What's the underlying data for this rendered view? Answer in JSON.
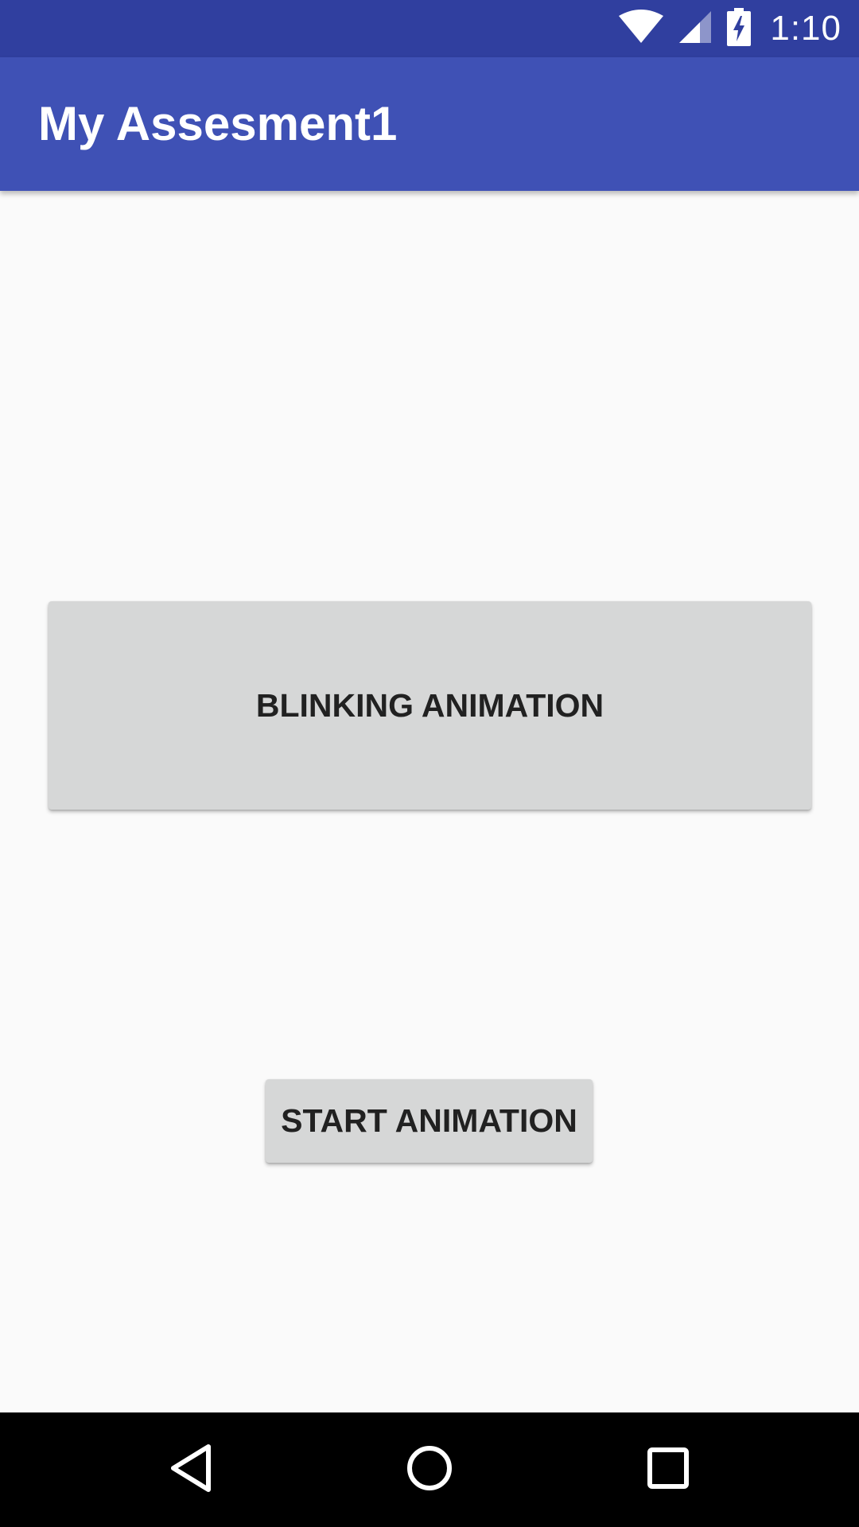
{
  "status_bar": {
    "time": "1:10",
    "icons": [
      "wifi-icon",
      "cell-signal-icon",
      "battery-charging-icon"
    ],
    "background_color": "#303f9f"
  },
  "app_bar": {
    "title": "My Assesment1",
    "background_color": "#3f51b5"
  },
  "main": {
    "blink_button_label": "BLINKING ANIMATION",
    "start_button_label": "START ANIMATION"
  },
  "nav_bar": {
    "icons": [
      "back-icon",
      "home-icon",
      "recent-apps-icon"
    ]
  }
}
